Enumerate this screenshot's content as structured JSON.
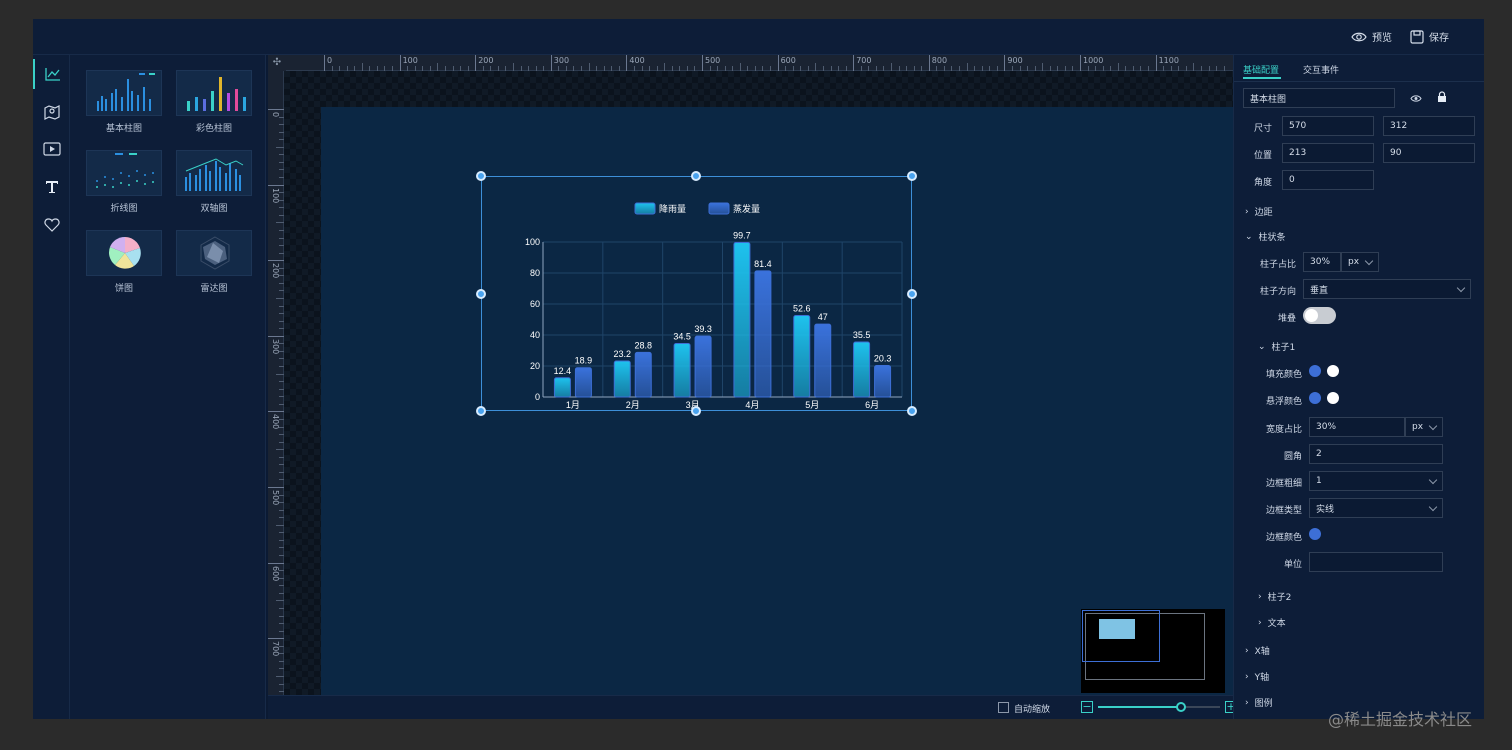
{
  "topbar": {
    "preview_label": "预览",
    "save_label": "保存"
  },
  "library": {
    "items": [
      {
        "label": "基本柱图"
      },
      {
        "label": "彩色柱图"
      },
      {
        "label": "折线图"
      },
      {
        "label": "双轴图"
      },
      {
        "label": "饼图"
      },
      {
        "label": "雷达图"
      }
    ]
  },
  "ruler": {
    "h_labels": [
      "0",
      "100",
      "200",
      "300",
      "400",
      "500",
      "600",
      "700",
      "800",
      "900",
      "1000",
      "1100"
    ],
    "v_labels": [
      "0",
      "100",
      "200",
      "300",
      "400",
      "500",
      "600",
      "700"
    ]
  },
  "chart_data": {
    "type": "bar",
    "categories": [
      "1月",
      "2月",
      "3月",
      "4月",
      "5月",
      "6月"
    ],
    "series": [
      {
        "name": "降雨量",
        "values": [
          12.4,
          23.2,
          34.5,
          99.7,
          52.6,
          35.5
        ],
        "color": "#1ec2ee"
      },
      {
        "name": "蒸发量",
        "values": [
          18.9,
          28.8,
          39.3,
          81.4,
          47,
          20.3
        ],
        "color": "#3a72dc"
      }
    ],
    "ylim": [
      0,
      100
    ],
    "yticks": [
      "0",
      "20",
      "40",
      "60",
      "80",
      "100"
    ],
    "grid": true,
    "legend": "top-center",
    "data_labels": true
  },
  "bottombar": {
    "auto_zoom_label": "自动缩放",
    "zoom_value": 0.68
  },
  "panel": {
    "tabs": [
      {
        "label": "基础配置",
        "active": true
      },
      {
        "label": "交互事件",
        "active": false
      }
    ],
    "name_value": "基本柱图",
    "size": {
      "label": "尺寸",
      "width": "570",
      "height": "312"
    },
    "position": {
      "label": "位置",
      "x": "213",
      "y": "90"
    },
    "angle": {
      "label": "角度",
      "value": "0"
    },
    "margin_section": "边距",
    "bar_section": "柱状条",
    "bar_ratio": {
      "label": "柱子占比",
      "value": "30%",
      "unit": "px"
    },
    "bar_direction": {
      "label": "柱子方向",
      "value": "垂直"
    },
    "stack": {
      "label": "堆叠",
      "on": false
    },
    "bar1": {
      "title": "柱子1",
      "fill": {
        "label": "填充颜色",
        "color1": "#3d6fd6",
        "color2": "#ffffff"
      },
      "hover": {
        "label": "悬浮颜色",
        "color1": "#3d6fd6",
        "color2": "#ffffff"
      },
      "width_ratio": {
        "label": "宽度占比",
        "value": "30%",
        "unit": "px"
      },
      "radius": {
        "label": "圆角",
        "value": "2"
      },
      "border_width": {
        "label": "边框粗细",
        "value": "1"
      },
      "border_type": {
        "label": "边框类型",
        "value": "实线"
      },
      "border_color": {
        "label": "边框颜色",
        "color": "#3d6fd6"
      },
      "unit": {
        "label": "单位",
        "value": ""
      }
    },
    "bar2_section": "柱子2",
    "text_section": "文本",
    "xaxis_section": "X轴",
    "yaxis_section": "Y轴",
    "legend_section": "图例"
  },
  "watermark": "@稀土掘金技术社区"
}
